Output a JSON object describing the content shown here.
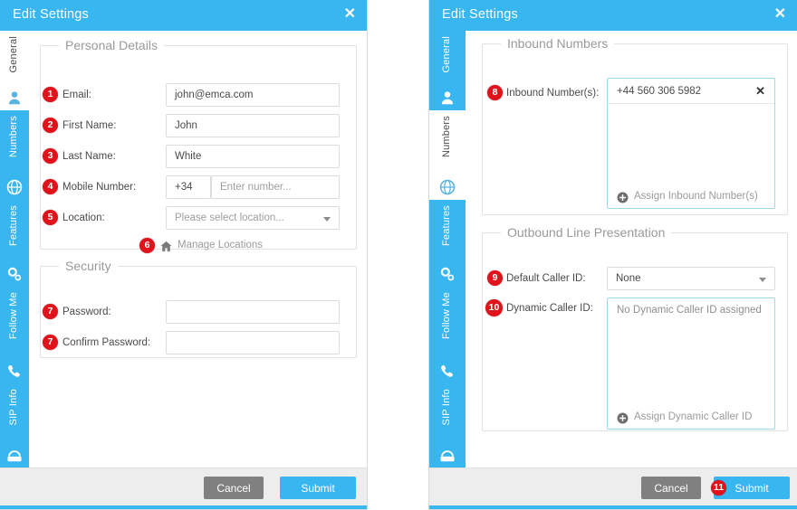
{
  "colors": {
    "accent": "#38b6f0",
    "badge": "#e0121b",
    "cancel": "#808080",
    "footer_bg": "#ededed",
    "field_border": "#dcdcdc",
    "listbox_border": "#9fd8f2"
  },
  "left_panel": {
    "title": "Edit Settings",
    "close_label": "✕",
    "tabs": [
      {
        "label": "General",
        "icon": "user-icon",
        "active": true
      },
      {
        "label": "Numbers",
        "icon": "globe-icon",
        "active": false
      },
      {
        "label": "Features",
        "icon": "gears-icon",
        "active": false
      },
      {
        "label": "Follow Me",
        "icon": "phone-forward-icon",
        "active": false
      },
      {
        "label": "SIP Info",
        "icon": "telephone-icon",
        "active": false
      }
    ],
    "personal_details": {
      "legend": "Personal Details",
      "email": {
        "badge": "1",
        "label": "Email:",
        "value": "john@emca.com"
      },
      "first_name": {
        "badge": "2",
        "label": "First Name:",
        "value": "John"
      },
      "last_name": {
        "badge": "3",
        "label": "Last Name:",
        "value": "White"
      },
      "mobile_number": {
        "badge": "4",
        "label": "Mobile Number:",
        "country_code": "+34",
        "placeholder": "Enter number..."
      },
      "location": {
        "badge": "5",
        "label": "Location:",
        "selected": "Please select location..."
      },
      "manage_locations": {
        "badge": "6",
        "label": "Manage Locations",
        "icon": "home-icon"
      }
    },
    "security": {
      "legend": "Security",
      "password": {
        "badge": "7",
        "label": "Password:",
        "value": "",
        "reveal_icon": "eye-icon"
      },
      "confirm_password": {
        "badge": "7",
        "label": "Confirm Password:",
        "value": "",
        "reveal_icon": "eye-icon"
      }
    },
    "footer": {
      "cancel": "Cancel",
      "submit": "Submit"
    }
  },
  "right_panel": {
    "title": "Edit Settings",
    "close_label": "✕",
    "tabs": [
      {
        "label": "General",
        "icon": "user-icon",
        "active": false
      },
      {
        "label": "Numbers",
        "icon": "globe-icon",
        "active": true
      },
      {
        "label": "Features",
        "icon": "gears-icon",
        "active": false
      },
      {
        "label": "Follow Me",
        "icon": "phone-forward-icon",
        "active": false
      },
      {
        "label": "SIP Info",
        "icon": "telephone-icon",
        "active": false
      }
    ],
    "inbound_numbers": {
      "legend": "Inbound Numbers",
      "field": {
        "badge": "8",
        "label": "Inbound Number(s):",
        "items": [
          {
            "number": "+44 560 306 5982",
            "remove_label": "✕"
          }
        ],
        "assign_link": "Assign Inbound Number(s)",
        "assign_icon": "plus-circle-icon"
      }
    },
    "outbound_line_presentation": {
      "legend": "Outbound Line Presentation",
      "default_caller_id": {
        "badge": "9",
        "label": "Default Caller ID:",
        "selected": "None"
      },
      "dynamic_caller_id": {
        "badge": "10",
        "label": "Dynamic Caller ID:",
        "empty_text": "No Dynamic Caller ID assigned",
        "assign_link": "Assign Dynamic Caller ID",
        "assign_icon": "plus-circle-icon"
      }
    },
    "footer": {
      "cancel": "Cancel",
      "submit": "Submit",
      "submit_badge": "11"
    }
  }
}
